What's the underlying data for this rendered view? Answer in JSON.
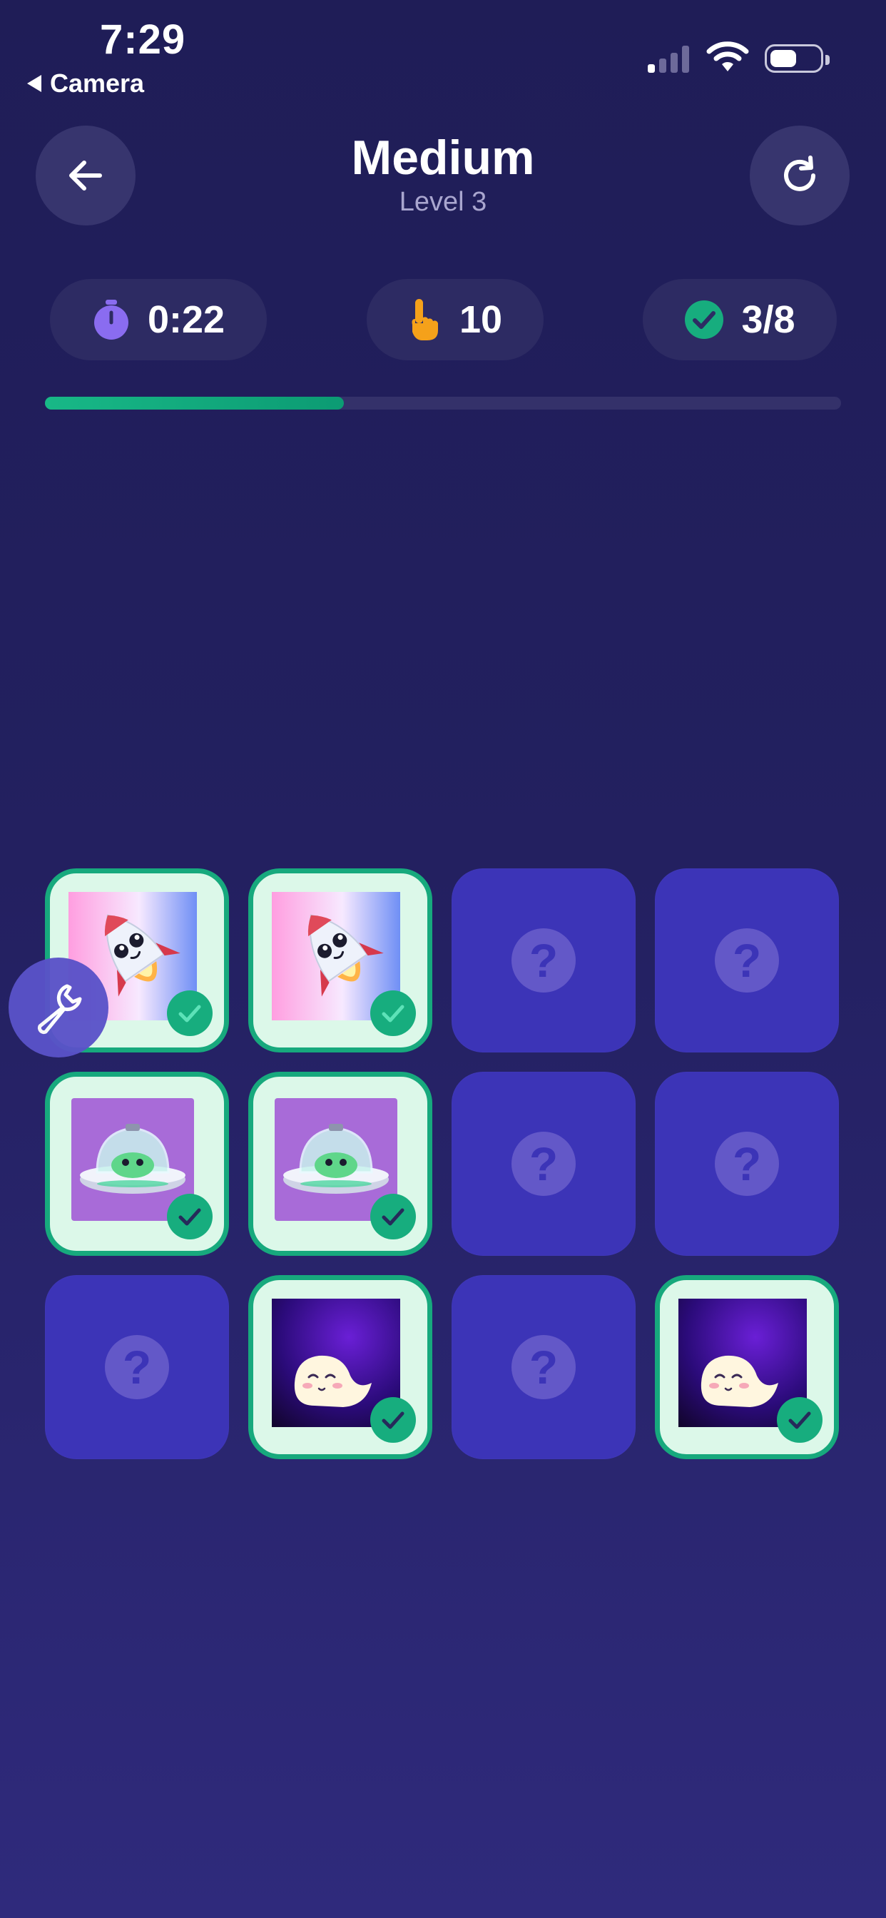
{
  "status_bar": {
    "time": "7:29",
    "back_app": "Camera"
  },
  "header": {
    "title": "Medium",
    "subtitle": "Level 3"
  },
  "stats": {
    "time": "0:22",
    "moves": "10",
    "matched": "3/8"
  },
  "progress": {
    "fraction": 0.375
  },
  "icons": {
    "back": "arrow-left-icon",
    "restart": "restart-icon",
    "timer": "stopwatch-icon",
    "moves": "pointing-hand-icon",
    "matched": "check-circle-icon",
    "tools": "wrench-icon"
  },
  "colors": {
    "accent_green": "#17ad7e",
    "hidden_card": "#3c34b7",
    "timer_purple": "#8a6cf0",
    "hand_orange": "#f5a11a"
  },
  "cards": [
    {
      "row": 1,
      "col": 1,
      "state": "matched",
      "image": "rocket"
    },
    {
      "row": 1,
      "col": 2,
      "state": "matched",
      "image": "rocket"
    },
    {
      "row": 1,
      "col": 3,
      "state": "hidden",
      "label": "?"
    },
    {
      "row": 1,
      "col": 4,
      "state": "hidden",
      "label": "?"
    },
    {
      "row": 2,
      "col": 1,
      "state": "matched",
      "image": "ufo"
    },
    {
      "row": 2,
      "col": 2,
      "state": "matched",
      "image": "ufo"
    },
    {
      "row": 2,
      "col": 3,
      "state": "hidden",
      "label": "?"
    },
    {
      "row": 2,
      "col": 4,
      "state": "hidden",
      "label": "?"
    },
    {
      "row": 3,
      "col": 1,
      "state": "hidden",
      "label": "?"
    },
    {
      "row": 3,
      "col": 2,
      "state": "matched",
      "image": "ghost"
    },
    {
      "row": 3,
      "col": 3,
      "state": "hidden",
      "label": "?"
    },
    {
      "row": 3,
      "col": 4,
      "state": "matched",
      "image": "ghost"
    }
  ]
}
